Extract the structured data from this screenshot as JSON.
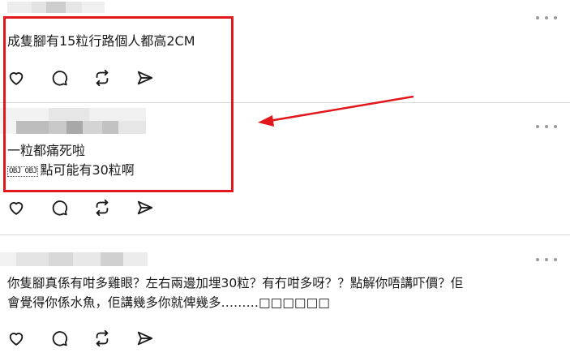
{
  "posts": [
    {
      "text_lines": [
        "成隻腳有15粒行路個人都高2CM"
      ]
    },
    {
      "text_lines": [
        "一粒都痛死啦"
      ],
      "emoji_box_text": "OBJ OBJ",
      "line2_text": "點可能有30粒啊"
    },
    {
      "text_lines": [
        "你隻腳真係有咁多雞眼？左右兩邊加埋30粒？有冇咁多呀？？點解你唔講吓價？佢",
        "會覺得你係水魚，佢講幾多你就俾幾多………□□□□□□"
      ]
    }
  ],
  "icons": [
    "heart-icon",
    "comment-icon",
    "repost-icon",
    "share-icon",
    "more-icon"
  ],
  "colors": {
    "highlight": "#e0181b",
    "arrow": "#e0181b",
    "icon": "#1a1a1a",
    "divider": "#dbdbdb"
  }
}
